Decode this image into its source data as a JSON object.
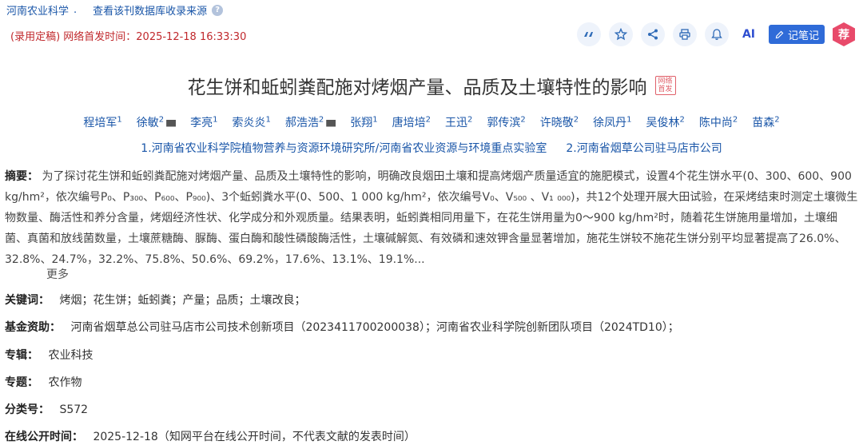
{
  "top": {
    "source_journal": "河南农业科学",
    "separator": ".",
    "check_source": "查看该刊数据库收录来源",
    "help": "?"
  },
  "pub_notice": "(录用定稿) 网络首发时间：2025-12-18 16:33:30",
  "toolbar": {
    "quote": "“",
    "note_label": "记笔记",
    "ai_label": "AI",
    "recommend_label": "荐"
  },
  "title": "花生饼和蚯蚓粪配施对烤烟产量、品质及土壤特性的影响",
  "stamp": "网络首发",
  "authors": [
    {
      "name": "程培军",
      "sup": "1"
    },
    {
      "name": "徐敏",
      "sup": "2"
    },
    {
      "name": "李亮",
      "sup": "1"
    },
    {
      "name": "索炎炎",
      "sup": "1"
    },
    {
      "name": "郝浩浩",
      "sup": "2"
    },
    {
      "name": "张翔",
      "sup": "1"
    },
    {
      "name": "唐培培",
      "sup": "2"
    },
    {
      "name": "王迅",
      "sup": "2"
    },
    {
      "name": "郭传滨",
      "sup": "2"
    },
    {
      "name": "许晓敬",
      "sup": "2"
    },
    {
      "name": "徐凤丹",
      "sup": "1"
    },
    {
      "name": "吴俊林",
      "sup": "2"
    },
    {
      "name": "陈中尚",
      "sup": "2"
    },
    {
      "name": "苗森",
      "sup": "2"
    }
  ],
  "affiliations": [
    "1.河南省农业科学院植物营养与资源环境研究所/河南省农业资源与环境重点实验室",
    "2.河南省烟草公司驻马店市公司"
  ],
  "abstract": {
    "label": "摘要：",
    "text": "为了探讨花生饼和蚯蚓粪配施对烤烟产量、品质及土壤特性的影响，明确改良烟田土壤和提高烤烟产质量适宜的施肥模式，设置4个花生饼水平(0、300、600、900 kg/hm²，依次编号P₀、P₃₀₀、P₆₀₀、P₉₀₀)、3个蚯蚓粪水平(0、500、1 000 kg/hm²，依次编号V₀、V₅₀₀ 、V₁ ₀₀₀)，共12个处理开展大田试验，在采烤结束时测定土壤微生物数量、酶活性和养分含量，烤烟经济性状、化学成分和外观质量。结果表明，蚯蚓粪相同用量下，在花生饼用量为0～900 kg/hm²时，随着花生饼施用量增加，土壤细菌、真菌和放线菌数量，土壤蔗糖酶、脲酶、蛋白酶和酸性磷酸酶活性，土壤碱解氮、有效磷和速效钾含量显著增加，施花生饼较不施花生饼分别平均显著提高了26.0%、32.8%、24.7%，32.2%、75.8%、50.6%、69.2%，17.6%、13.1%、19.1%...",
    "more": "更多"
  },
  "keywords": {
    "label": "关键词：",
    "value": "烤烟；花生饼；蚯蚓粪；产量；品质；土壤改良；"
  },
  "funding": {
    "label": "基金资助：",
    "value": "河南省烟草总公司驻马店市公司技术创新项目（2023411700200038）；河南省农业科学院创新团队项目（2024TD10）；"
  },
  "collection": {
    "label": "专辑：",
    "value": "农业科技"
  },
  "topic": {
    "label": "专题：",
    "value": "农作物"
  },
  "classification": {
    "label": "分类号：",
    "value": "S572"
  },
  "online_time": {
    "label": "在线公开时间：",
    "value": "2025-12-18（知网平台在线公开时间，不代表文献的发表时间）"
  }
}
